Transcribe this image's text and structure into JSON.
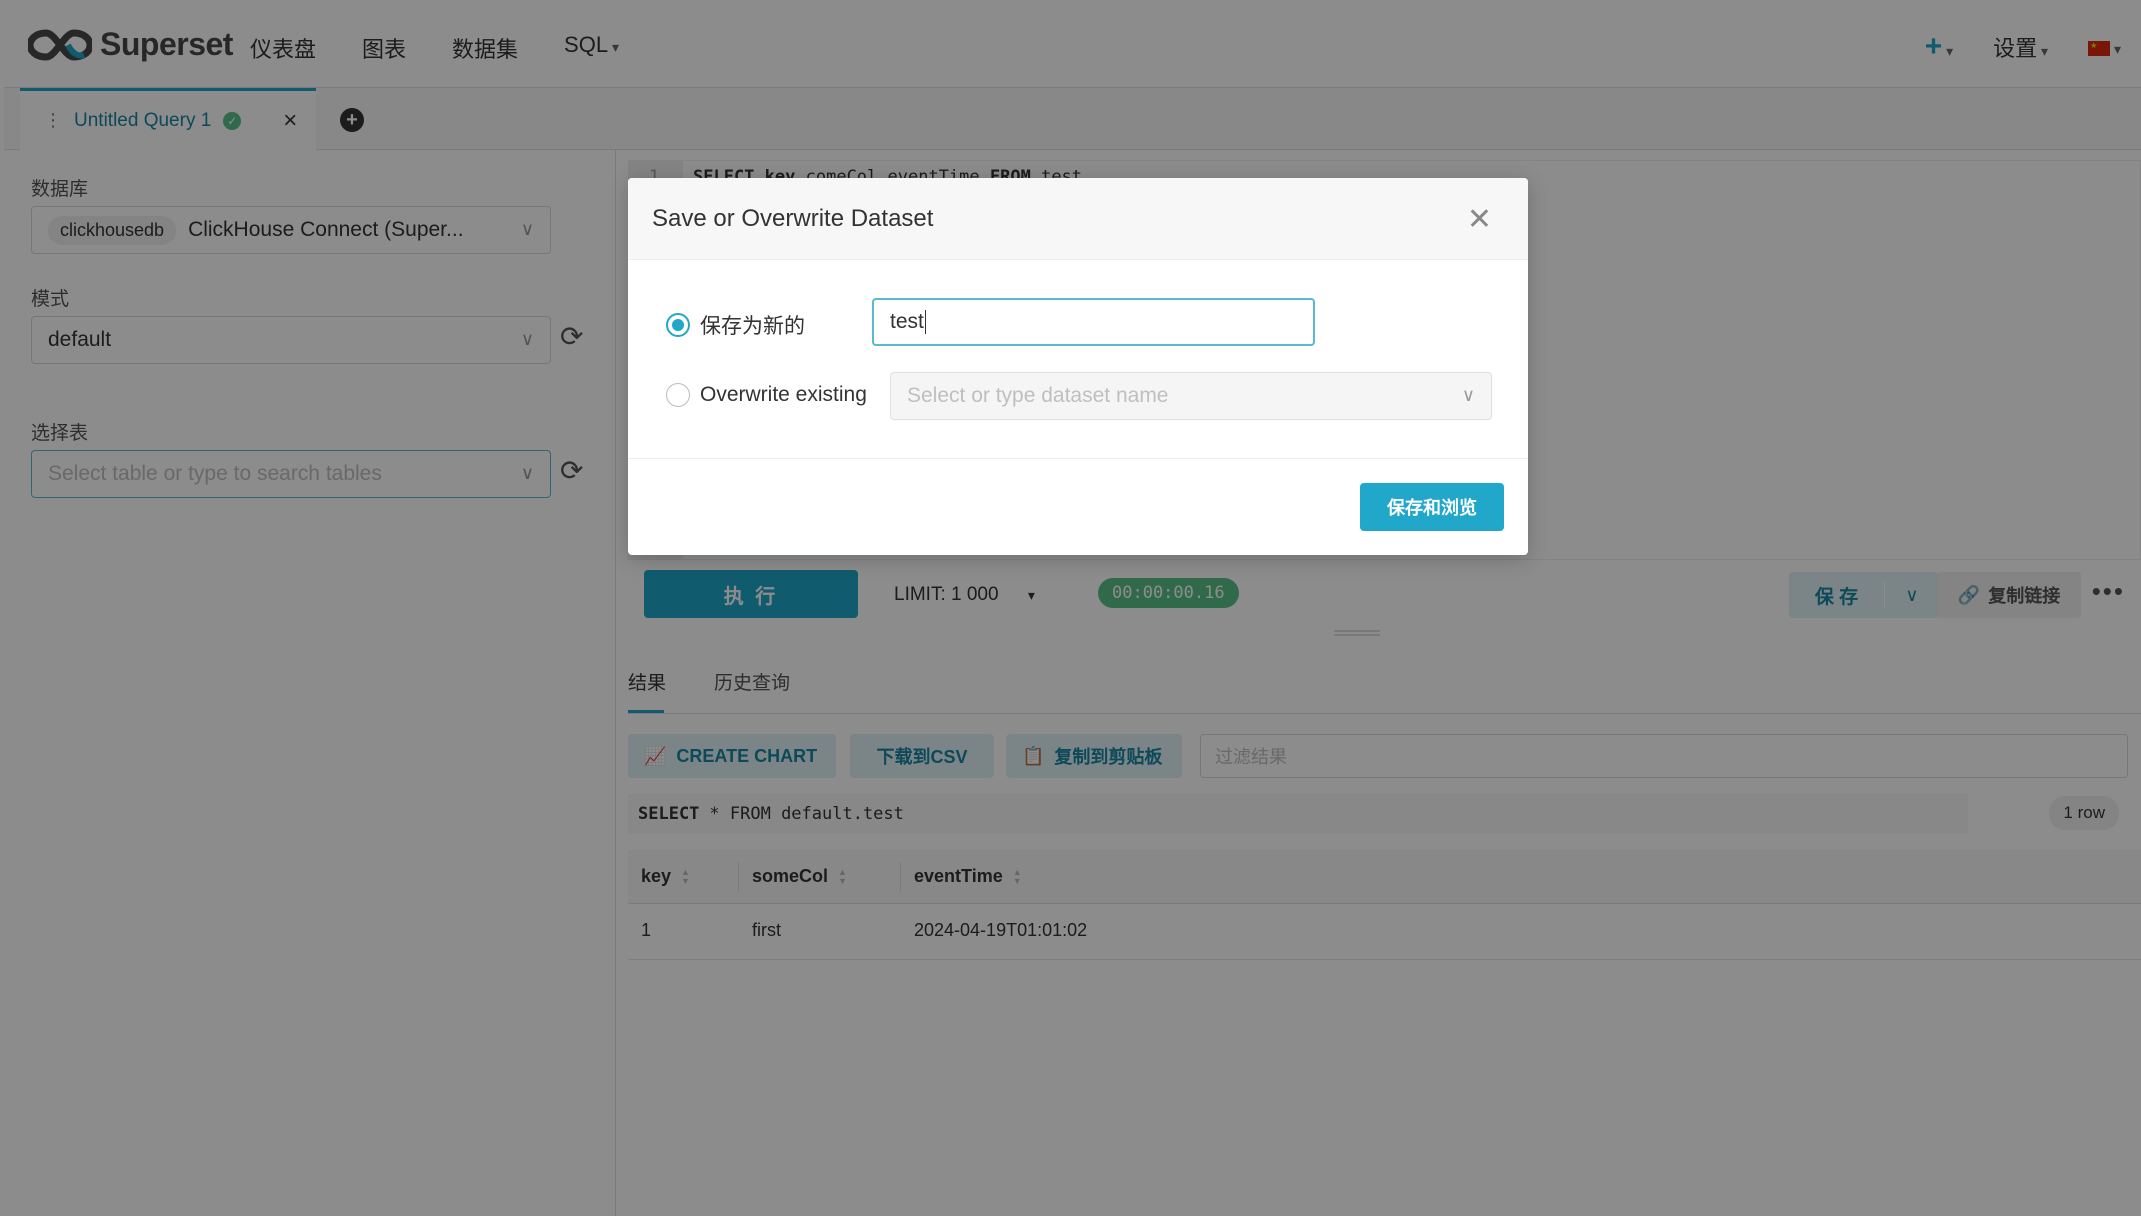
{
  "navbar": {
    "brand": "Superset",
    "menu": [
      "仪表盘",
      "图表",
      "数据集",
      "SQL"
    ],
    "plus_label": "+",
    "settings_label": "设置"
  },
  "tabs": {
    "query_title": "Untitled Query 1",
    "close_glyph": "×",
    "add_glyph": "+"
  },
  "left_panel": {
    "database_label": "数据库",
    "database_chip": "clickhousedb",
    "database_value": "ClickHouse Connect (Super...",
    "schema_label": "模式",
    "schema_value": "default",
    "table_label": "选择表",
    "table_placeholder": "Select table or type to search tables"
  },
  "editor": {
    "line_no": "1",
    "code_keyword_select": "SELECT",
    "code_key": "key",
    "code_rest": ",comeCol,eventTime",
    "code_keyword_from": "FROM",
    "code_table": "test"
  },
  "toolbar": {
    "run_label": "执 行",
    "limit_label": "LIMIT:",
    "limit_value": "1 000",
    "timer": "00:00:00.16",
    "save_label": "保 存",
    "copy_link_label": "复制链接",
    "more_glyph": "•••"
  },
  "results": {
    "tab_results": "结果",
    "tab_history": "历史查询",
    "create_chart_label": "CREATE CHART",
    "download_csv_label": "下载到CSV",
    "copy_clipboard_label": "复制到剪贴板",
    "filter_placeholder": "过滤结果",
    "sql_keyword_select": "SELECT",
    "sql_rest": "* FROM default.test",
    "row_count": "1 row",
    "columns": [
      "key",
      "someCol",
      "eventTime"
    ],
    "rows": [
      [
        "1",
        "first",
        "2024-04-19T01:01:02"
      ]
    ]
  },
  "modal": {
    "title": "Save or Overwrite Dataset",
    "close_glyph": "✕",
    "save_new_label": "保存为新的",
    "dataset_name_value": "test",
    "overwrite_label": "Overwrite existing",
    "overwrite_placeholder": "Select or type dataset name",
    "save_browse_label": "保存和浏览"
  },
  "colors": {
    "primary": "#20a7c9",
    "success": "#5ac189"
  }
}
